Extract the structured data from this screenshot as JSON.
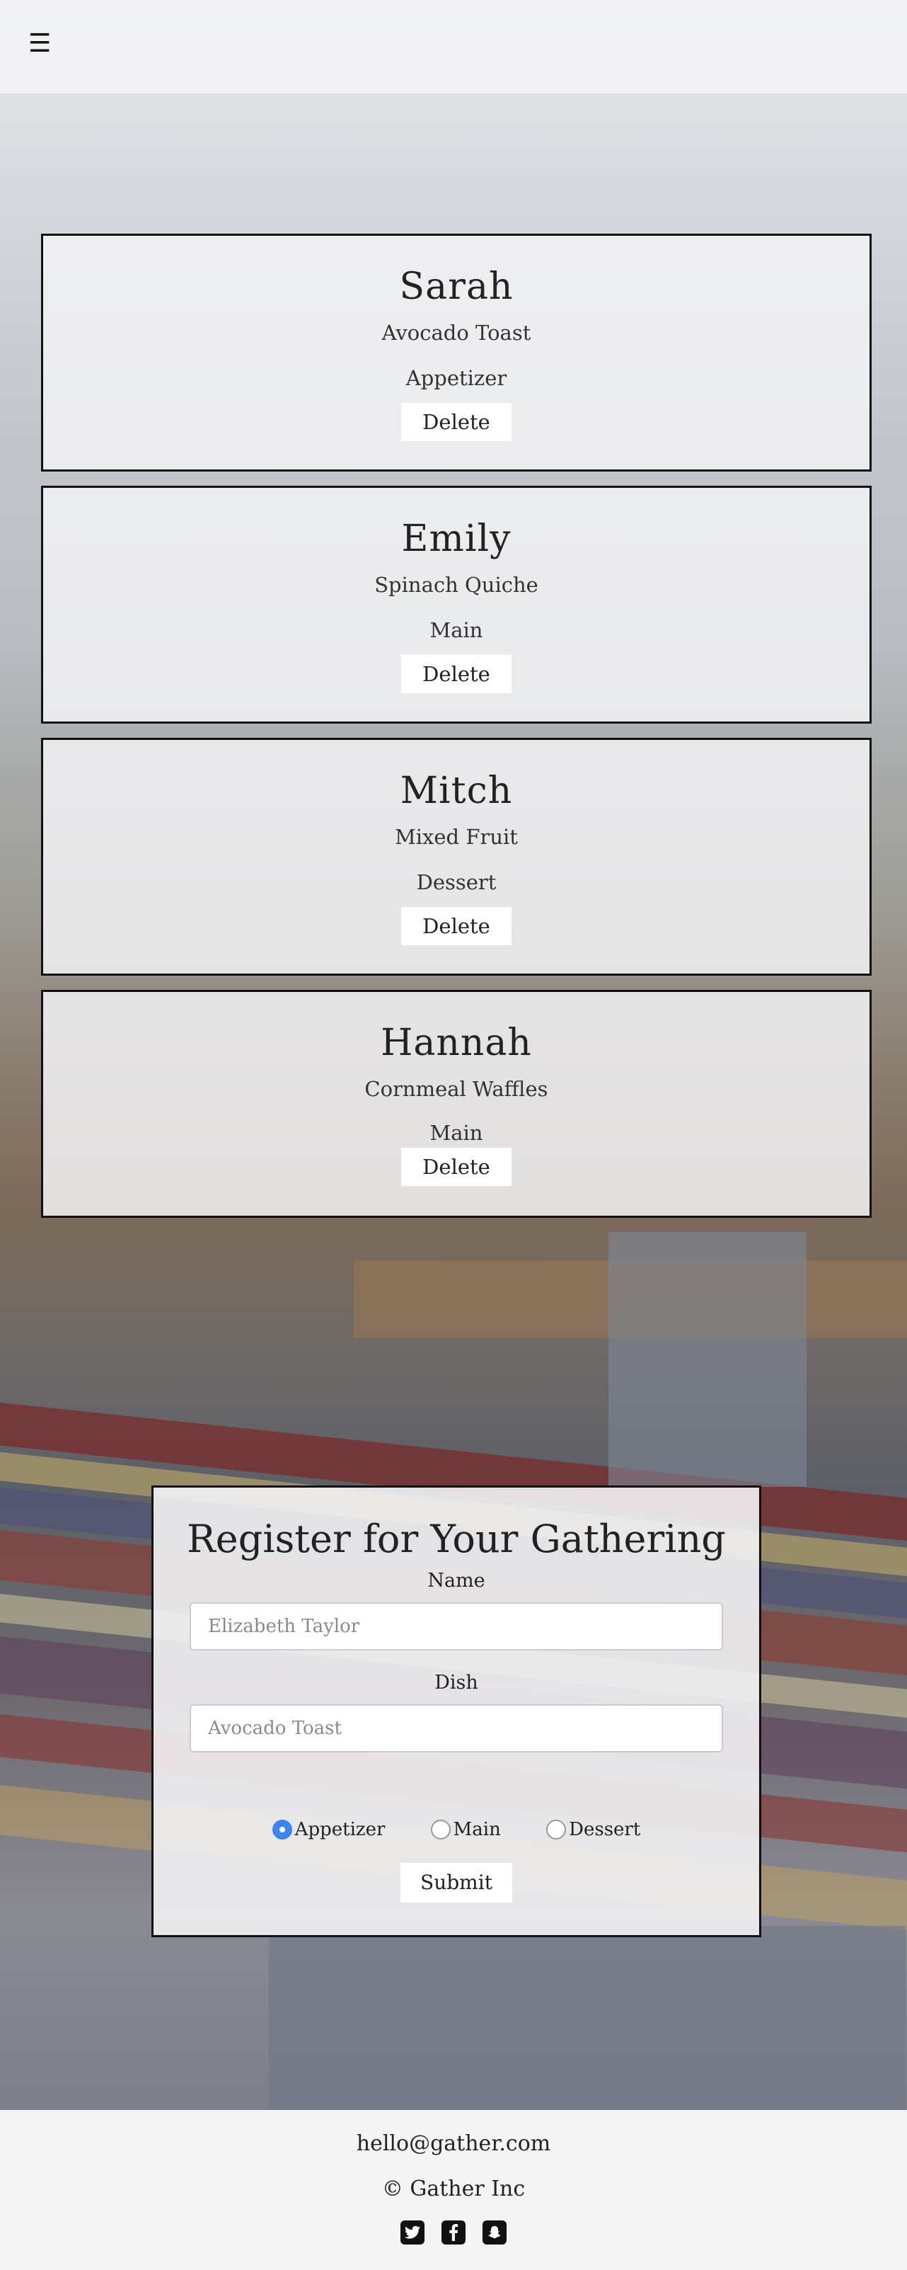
{
  "header": {
    "menu_icon": "hamburger-icon",
    "menu_glyph": "☰"
  },
  "entries": [
    {
      "name": "Sarah",
      "dish": "Avocado Toast",
      "course": "Appetizer",
      "delete_label": "Delete"
    },
    {
      "name": "Emily",
      "dish": "Spinach Quiche",
      "course": "Main",
      "delete_label": "Delete"
    },
    {
      "name": "Mitch",
      "dish": "Mixed Fruit",
      "course": "Dessert",
      "delete_label": "Delete"
    },
    {
      "name": "Hannah",
      "dish": "Cornmeal Waffles",
      "course": "Main",
      "delete_label": "Delete"
    }
  ],
  "form": {
    "title": "Register for Your Gathering",
    "name_label": "Name",
    "name_placeholder": "Elizabeth Taylor",
    "dish_label": "Dish",
    "dish_placeholder": "Avocado Toast",
    "course_options": [
      "Appetizer",
      "Main",
      "Dessert"
    ],
    "selected_course": "Appetizer",
    "submit_label": "Submit"
  },
  "footer": {
    "email": "hello@gather.com",
    "copyright": "© Gather Inc",
    "social_icons": [
      "twitter-icon",
      "facebook-icon",
      "snapchat-icon"
    ]
  },
  "colors": {
    "accent": "#3b86f0",
    "card_border": "#111111",
    "footer_bg": "#f4f4f4"
  }
}
